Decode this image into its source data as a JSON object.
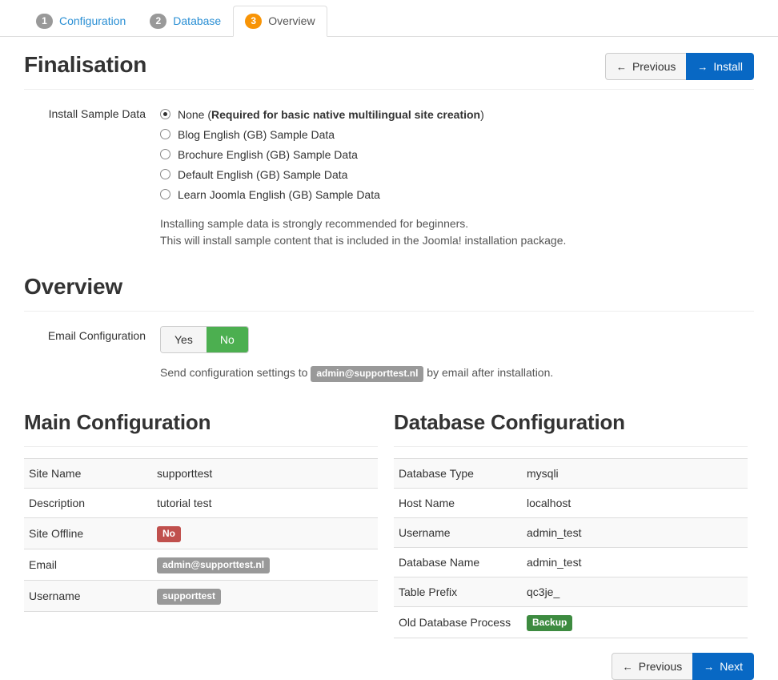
{
  "tabs": [
    {
      "num": "1",
      "label": "Configuration",
      "active": false
    },
    {
      "num": "2",
      "label": "Database",
      "active": false
    },
    {
      "num": "3",
      "label": "Overview",
      "active": true
    }
  ],
  "finalisation": {
    "title": "Finalisation",
    "previous_label": "Previous",
    "install_label": "Install",
    "arrow_left": "←",
    "arrow_right": "→",
    "sample_data_label": "Install Sample Data",
    "options": [
      {
        "label": "None (",
        "bold": "Required for basic native multilingual site creation",
        "tail": ")",
        "checked": true
      },
      {
        "label": "Blog English (GB) Sample Data",
        "checked": false
      },
      {
        "label": "Brochure English (GB) Sample Data",
        "checked": false
      },
      {
        "label": "Default English (GB) Sample Data",
        "checked": false
      },
      {
        "label": "Learn Joomla English (GB) Sample Data",
        "checked": false
      }
    ],
    "help_line_1": "Installing sample data is strongly recommended for beginners.",
    "help_line_2": "This will install sample content that is included in the Joomla! installation package."
  },
  "overview": {
    "title": "Overview",
    "email_config_label": "Email Configuration",
    "toggle_yes": "Yes",
    "toggle_no": "No",
    "toggle_selected": "No",
    "send_note_prefix": "Send configuration settings to",
    "send_note_email": "admin@supporttest.nl",
    "send_note_suffix": "by email after installation."
  },
  "main_configuration": {
    "title": "Main Configuration",
    "rows": [
      {
        "key": "Site Name",
        "value": "supporttest",
        "style": "plain"
      },
      {
        "key": "Description",
        "value": "tutorial test",
        "style": "plain"
      },
      {
        "key": "Site Offline",
        "value": "No",
        "style": "tag-red"
      },
      {
        "key": "Email",
        "value": "admin@supporttest.nl",
        "style": "tag-grey"
      },
      {
        "key": "Username",
        "value": "supporttest",
        "style": "tag-grey"
      }
    ]
  },
  "database_configuration": {
    "title": "Database Configuration",
    "rows": [
      {
        "key": "Database Type",
        "value": "mysqli",
        "style": "plain"
      },
      {
        "key": "Host Name",
        "value": "localhost",
        "style": "plain"
      },
      {
        "key": "Username",
        "value": "admin_test",
        "style": "plain"
      },
      {
        "key": "Database Name",
        "value": "admin_test",
        "style": "plain"
      },
      {
        "key": "Table Prefix",
        "value": "qc3je_",
        "style": "plain"
      },
      {
        "key": "Old Database Process",
        "value": "Backup",
        "style": "tag-green"
      }
    ]
  },
  "footer": {
    "previous_label": "Previous",
    "next_label": "Next",
    "arrow_left": "←",
    "arrow_right": "→"
  },
  "colors": {
    "accent_blue": "#0868c4",
    "link_blue": "#2a8fd4",
    "active_step_orange": "#f89406",
    "step_grey": "#999999",
    "green": "#4caf50",
    "tag_green": "#3d8b40",
    "tag_red": "#c0504d",
    "tag_grey": "#999999"
  }
}
